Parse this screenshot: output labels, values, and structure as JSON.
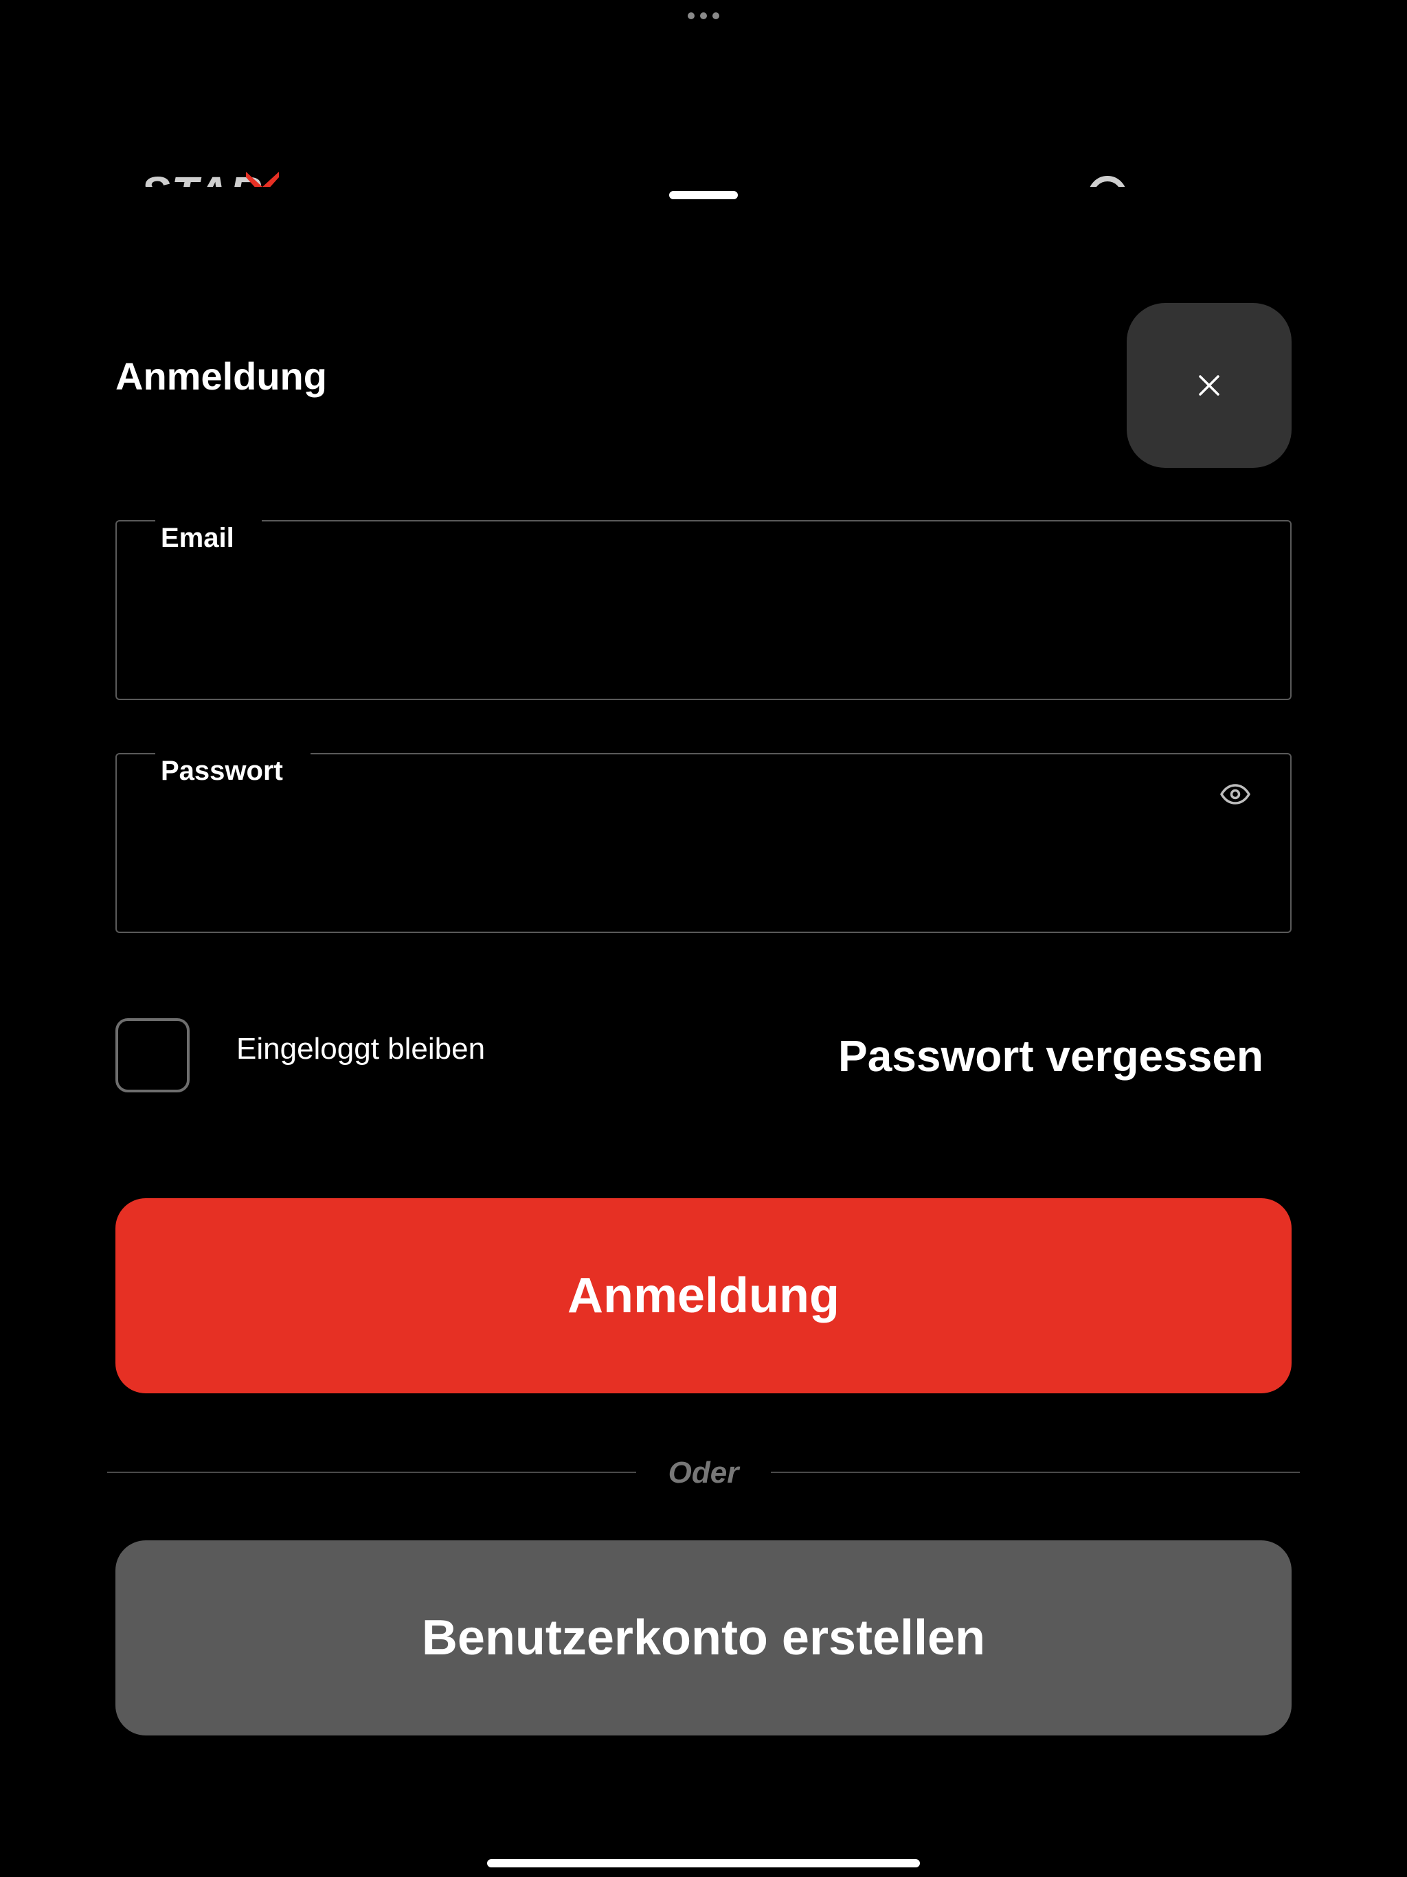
{
  "header": {
    "brand_label": "STAR",
    "brand_icon": "brand-logo",
    "profile_icon": "user-icon"
  },
  "sheet": {
    "title": "Anmeldung",
    "close_icon": "close-icon"
  },
  "form": {
    "email": {
      "label": "Email",
      "value": "",
      "placeholder": ""
    },
    "password": {
      "label": "Passwort",
      "value": "",
      "placeholder": "",
      "toggle_icon": "eye-icon"
    },
    "remember_me": {
      "label": "Eingeloggt bleiben",
      "checked": false
    },
    "forgot_password_label": "Passwort vergessen",
    "submit_label": "Anmeldung",
    "divider_label": "Oder",
    "create_account_label": "Benutzerkonto erstellen"
  },
  "colors": {
    "primary": "#e63024",
    "secondary": "#5a5a5a",
    "close_bg": "#333333",
    "background": "#000000"
  }
}
